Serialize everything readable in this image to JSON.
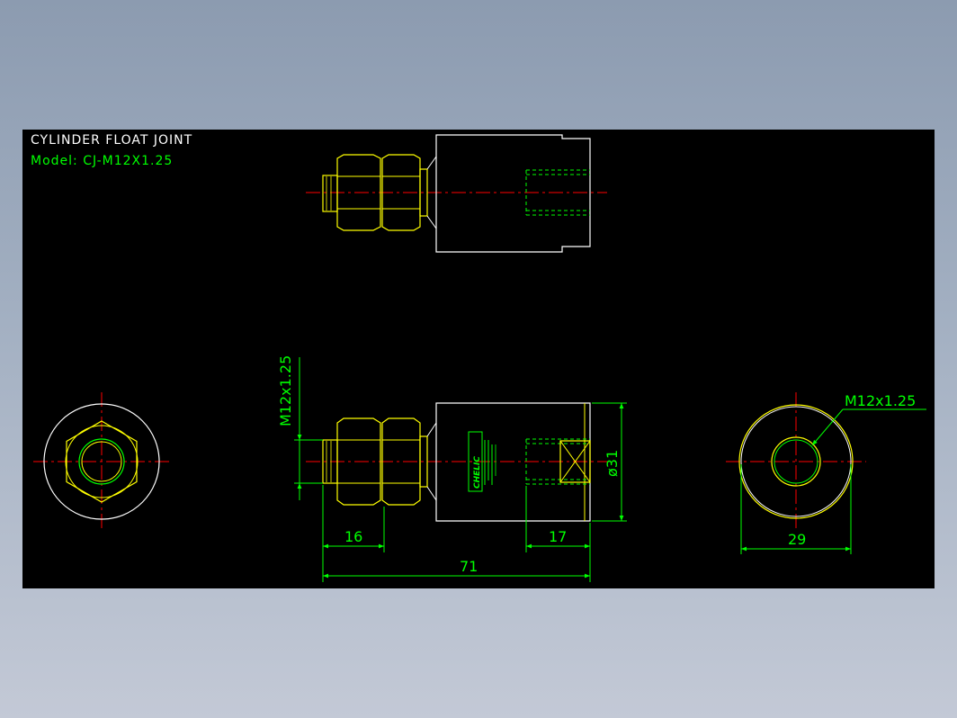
{
  "title": "CYLINDER FLOAT JOINT",
  "model": "Model: CJ-M12X1.25",
  "dimensions": {
    "thread_side": "M12x1.25",
    "thread_right": "M12x1.25",
    "nut_length": "16",
    "bore_depth": "17",
    "overall_length": "71",
    "body_diameter": "ø31",
    "end_diameter": "29"
  },
  "brand": "CHELIC",
  "colors": {
    "background": "#000000",
    "outline": "#ffff00",
    "dimension": "#00ff00",
    "centerline": "#ff0000",
    "body": "#ffffff"
  }
}
